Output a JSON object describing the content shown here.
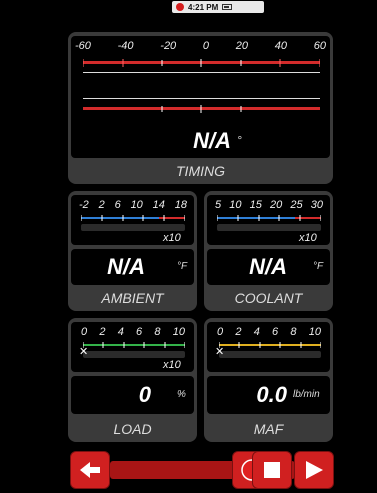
{
  "status": {
    "time": "4:21 PM",
    "recording_color": "#d41d1d"
  },
  "timing": {
    "scale": [
      "-60",
      "-40",
      "-20",
      "0",
      "20",
      "40",
      "60"
    ],
    "value": "N/A",
    "unit": "°",
    "label": "TIMING"
  },
  "ambient": {
    "scale": [
      "-2",
      "2",
      "6",
      "10",
      "14",
      "18"
    ],
    "multiplier": "x10",
    "value": "N/A",
    "unit": "°F",
    "label": "AMBIENT",
    "bar_color": "#2f7fd6"
  },
  "coolant": {
    "scale": [
      "5",
      "10",
      "15",
      "20",
      "25",
      "30"
    ],
    "multiplier": "x10",
    "value": "N/A",
    "unit": "°F",
    "label": "COOLANT",
    "bar_color": "#2f7fd6"
  },
  "load": {
    "scale": [
      "0",
      "2",
      "4",
      "6",
      "8",
      "10"
    ],
    "multiplier": "x10",
    "value": "0",
    "unit": "%",
    "label": "LOAD",
    "bar_color": "#34b34a"
  },
  "maf": {
    "scale": [
      "0",
      "2",
      "4",
      "6",
      "8",
      "10"
    ],
    "value": "0.0",
    "unit": "lb/min",
    "label": "MAF",
    "bar_color": "#e0b020"
  },
  "toolbar": {
    "icons": [
      "back-arrow-icon",
      "record-icon",
      "stop-icon",
      "play-icon"
    ],
    "accent": "#d02020"
  }
}
